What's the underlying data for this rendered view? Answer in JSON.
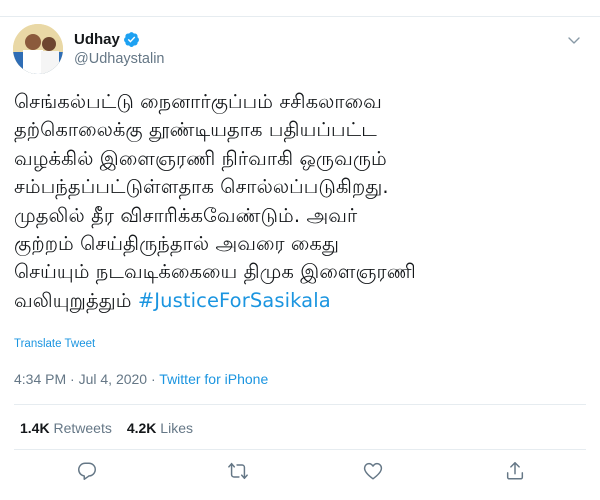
{
  "user": {
    "display_name": "Udhay",
    "handle": "@Udhaystalin",
    "verified": true
  },
  "tweet": {
    "lines": [
      "செங்கல்பட்டு நைனார்குப்பம் சசிகலாவை",
      "தற்கொலைக்கு தூண்டியதாக பதியப்பட்ட",
      "வழக்கில் இளைஞரணி நிர்வாகி ஒருவரும்",
      "சம்பந்தப்பட்டுள்ளதாக சொல்லப்படுகிறது.",
      "முதலில் தீர விசாரிக்கவேண்டும். அவர்",
      "குற்றம் செய்திருந்தால் அவரை கைது",
      "செய்யும் நடவடிக்கையை திமுக இளைஞரணி"
    ],
    "last_line_text": "வலியுறுத்தும் ",
    "hashtag": "#JusticeForSasikala"
  },
  "translate_label": "Translate Tweet",
  "meta": {
    "time": "4:34 PM",
    "separator": " · ",
    "date": "Jul 4, 2020",
    "source": "Twitter for iPhone"
  },
  "stats": {
    "retweets_count": "1.4K",
    "retweets_label": "Retweets",
    "likes_count": "4.2K",
    "likes_label": "Likes"
  },
  "icons": {
    "verified": "verified-badge-icon",
    "caret": "chevron-down-icon",
    "reply": "reply-icon",
    "retweet": "retweet-icon",
    "like": "heart-icon",
    "share": "share-icon"
  },
  "colors": {
    "link": "#1b95e0",
    "secondary_text": "#657786",
    "primary_text": "#14171a",
    "divider": "#e6ecf0"
  }
}
